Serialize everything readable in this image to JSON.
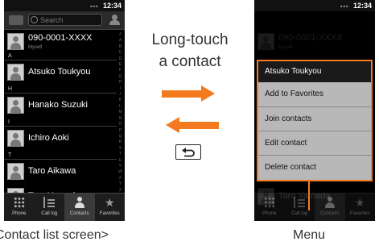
{
  "status_bar": {
    "time": "12:34"
  },
  "left_screen": {
    "search": {
      "placeholder": "Search"
    },
    "myself": {
      "number": "090-0001-XXXX",
      "sub": "Myself"
    },
    "sections": [
      {
        "letter": "A",
        "contact": "Atsuko Toukyou"
      },
      {
        "letter": "H",
        "contact": "Hanako Suzuki"
      },
      {
        "letter": "I",
        "contact": "Ichiro Aoki"
      },
      {
        "letter": "T",
        "contact": "Taro Aikawa"
      }
    ],
    "partial_contact": "Taro Yamada",
    "alpha_index": [
      "#",
      "A",
      "B",
      "C",
      "D",
      "E",
      "F",
      "G",
      "H",
      "I",
      "J",
      "K",
      "L",
      "M",
      "N",
      "O",
      "P",
      "Q",
      "R",
      "S",
      "T",
      "U",
      "V",
      "W",
      "X",
      "Y",
      "Z"
    ],
    "tabs": [
      {
        "label": "Phone",
        "icon": "dialpad-icon"
      },
      {
        "label": "Call log",
        "icon": "call-log-icon"
      },
      {
        "label": "Contacts",
        "icon": "contacts-icon",
        "active": true
      },
      {
        "label": "Favorites",
        "icon": "star-icon"
      }
    ]
  },
  "right_screen": {
    "menu": {
      "title": "Atsuko Toukyou",
      "items": [
        "Add to Favorites",
        "Join contacts",
        "Edit contact",
        "Delete contact"
      ]
    }
  },
  "annotations": {
    "instruction_line1": "Long-touch",
    "instruction_line2": "a contact",
    "left_caption": "Contact list screen>",
    "right_caption": "Menu",
    "back_key_icon": "back-key-icon",
    "accent_color": "#f47a20"
  }
}
